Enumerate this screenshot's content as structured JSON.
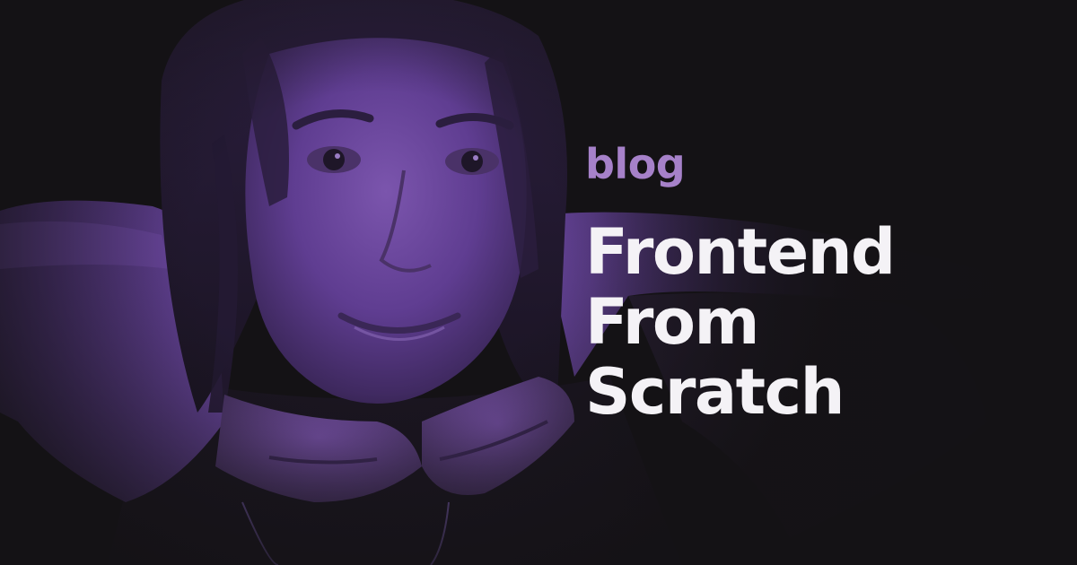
{
  "card": {
    "tag": "blog",
    "title_lines": [
      "Frontend",
      "From",
      "Scratch"
    ]
  },
  "image": {
    "description_name": "portrait-photo",
    "tint": "#5b3a8c"
  },
  "colors": {
    "background": "#141215",
    "tint_dark": "#2a1d40",
    "tint": "#5b3a8c",
    "tint_light": "#8a62b8",
    "tag": "#a681c9",
    "title": "#f4f2f6"
  }
}
